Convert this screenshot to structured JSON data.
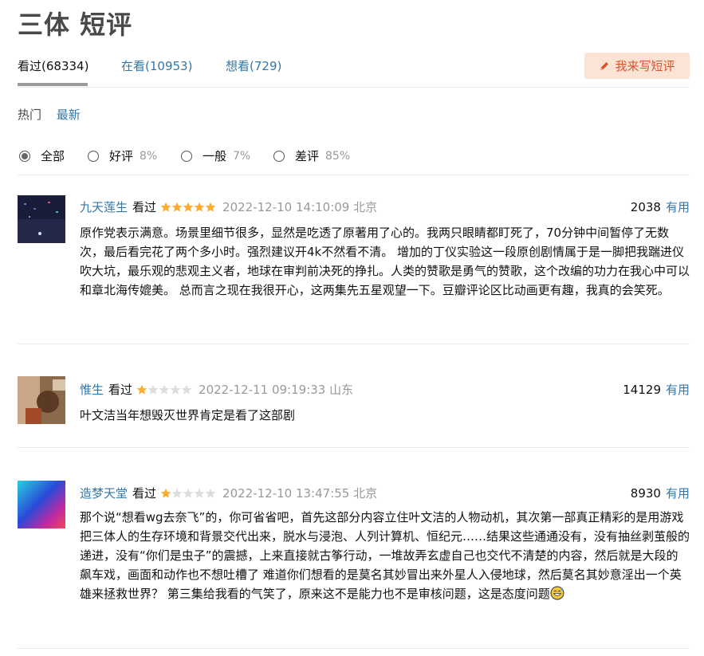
{
  "page_title": "三体 短评",
  "tabs": [
    {
      "label": "看过(68334)"
    },
    {
      "label": "在看(10953)"
    },
    {
      "label": "想看(729)"
    }
  ],
  "write_button": "我来写短评",
  "sort": {
    "hot": "热门",
    "latest": "最新"
  },
  "filters": [
    {
      "label": "全部",
      "pct": ""
    },
    {
      "label": "好评",
      "pct": "8%"
    },
    {
      "label": "一般",
      "pct": "7%"
    },
    {
      "label": "差评",
      "pct": "85%"
    }
  ],
  "colors": {
    "link": "#3377aa",
    "star": "#ffac2d",
    "star_empty": "#dddddd",
    "accent": "#d5542c"
  },
  "comments": [
    {
      "user": "九天莲生",
      "status": "看过",
      "rating": 5,
      "time": "2022-12-10 14:10:09 北京",
      "votes": "2038",
      "useful": "有用",
      "text": "原作党表示满意。场景里细节很多，显然是吃透了原著用了心的。我两只眼睛都盯死了，70分钟中间暂停了无数次，最后看完花了两个多小时。强烈建议开4k不然看不清。 增加的丁仪实验这一段原创剧情属于是一脚把我踹进仪吹大坑，最乐观的悲观主义者，地球在审判前决死的挣扎。人类的赞歌是勇气的赞歌，这个改编的功力在我心中可以和章北海传媲美。 总而言之现在我很开心，这两集先五星观望一下。豆瓣评论区比动画更有趣，我真的会笑死。"
    },
    {
      "user": "惟生",
      "status": "看过",
      "rating": 1,
      "time": "2022-12-11 09:19:33 山东",
      "votes": "14129",
      "useful": "有用",
      "text": "叶文洁当年想毁灭世界肯定是看了这部剧"
    },
    {
      "user": "造梦天堂",
      "status": "看过",
      "rating": 1,
      "time": "2022-12-10 13:47:55 北京",
      "votes": "8930",
      "useful": "有用",
      "text": "那个说“想看wg去奈飞”的，你可省省吧，首先这部分内容立住叶文洁的人物动机，其次第一部真正精彩的是用游戏把三体人的生存环境和背景交代出来，脱水与浸泡、人列计算机、恒纪元……结果这些通通没有，没有抽丝剥茧般的递进，没有“你们是虫子”的震撼，上来直接就古筝行动，一堆故弄玄虚自己也交代不清楚的内容，然后就是大段的飙车戏，画面和动作也不想吐槽了 难道你们想看的是莫名其妙冒出来外星人入侵地球，然后莫名其妙意淫出一个英雄来拯救世界？ 第三集给我看的气笑了，原来这不是能力也不是审核问题，这是态度问题"
    }
  ]
}
